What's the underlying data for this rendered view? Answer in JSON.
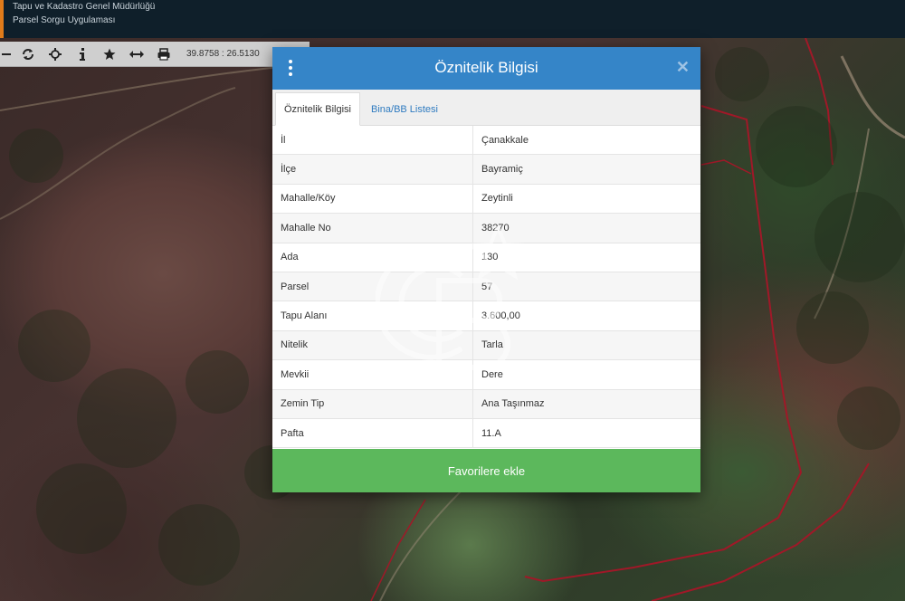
{
  "header": {
    "line1": "Tapu ve Kadastro Genel Müdürlüğü",
    "line2": "Parsel Sorgu Uygulaması"
  },
  "toolbar": {
    "coords": "39.8758 : 26.5130",
    "icons": [
      "zoom-out-icon",
      "refresh-icon",
      "locate-icon",
      "info-icon",
      "star-icon",
      "measure-icon",
      "print-icon"
    ]
  },
  "modal": {
    "title": "Öznitelik Bilgisi",
    "tabs": [
      {
        "label": "Öznitelik Bilgisi"
      },
      {
        "label": "Bina/BB Listesi"
      }
    ],
    "rows": [
      {
        "key": "İl",
        "value": "Çanakkale"
      },
      {
        "key": "İlçe",
        "value": "Bayramiç"
      },
      {
        "key": "Mahalle/Köy",
        "value": "Zeytinli"
      },
      {
        "key": "Mahalle No",
        "value": "38270"
      },
      {
        "key": "Ada",
        "value": "130"
      },
      {
        "key": "Parsel",
        "value": "57"
      },
      {
        "key": "Tapu Alanı",
        "value": "3.600,00"
      },
      {
        "key": "Nitelik",
        "value": "Tarla"
      },
      {
        "key": "Mevkii",
        "value": "Dere"
      },
      {
        "key": "Zemin Tip",
        "value": "Ana Taşınmaz"
      },
      {
        "key": "Pafta",
        "value": "11.A"
      }
    ],
    "favorite_label": "Favorilere ekle"
  },
  "colors": {
    "header_bg": "#0f1f2a",
    "modal_header": "#3585c8",
    "favorite_button": "#5cb85c",
    "tab_link": "#2f7bc0",
    "parcel_border": "#a01828"
  }
}
